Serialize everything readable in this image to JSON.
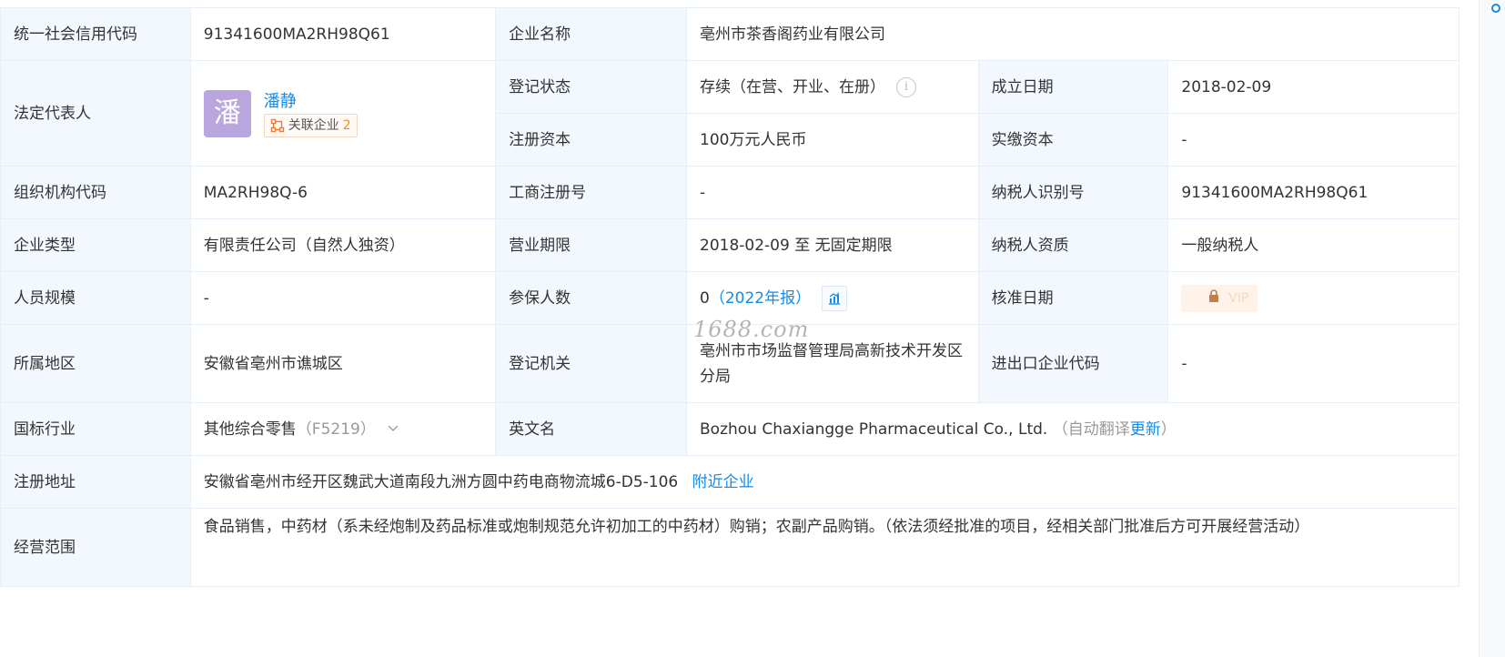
{
  "labels": {
    "credit_code": "统一社会信用代码",
    "company_name": "企业名称",
    "legal_rep": "法定代表人",
    "reg_status": "登记状态",
    "founded": "成立日期",
    "reg_capital": "注册资本",
    "paid_capital": "实缴资本",
    "org_code": "组织机构代码",
    "biz_reg_no": "工商注册号",
    "taxpayer_id": "纳税人识别号",
    "company_type": "企业类型",
    "biz_term": "营业期限",
    "taxpayer_qual": "纳税人资质",
    "staff_size": "人员规模",
    "insured": "参保人数",
    "approved_date": "核准日期",
    "region": "所属地区",
    "reg_authority": "登记机关",
    "import_export": "进出口企业代码",
    "industry": "国标行业",
    "english_name": "英文名",
    "address": "注册地址",
    "scope": "经营范围"
  },
  "values": {
    "credit_code": "91341600MA2RH98Q61",
    "company_name": "亳州市茶香阁药业有限公司",
    "legal_rep": {
      "avatar_char": "潘",
      "name": "潘静",
      "related_label": "关联企业",
      "related_count": "2"
    },
    "reg_status": "存续（在营、开业、在册）",
    "founded": "2018-02-09",
    "reg_capital": "100万元人民币",
    "paid_capital": "-",
    "org_code": "MA2RH98Q-6",
    "biz_reg_no": "-",
    "taxpayer_id": "91341600MA2RH98Q61",
    "company_type": "有限责任公司（自然人独资）",
    "biz_term": "2018-02-09 至 无固定期限",
    "taxpayer_qual": "一般纳税人",
    "staff_size": "-",
    "insured": {
      "count": "0",
      "report": "（2022年报）"
    },
    "approved_date": {
      "badge": "VIP"
    },
    "region": "安徽省亳州市谯城区",
    "reg_authority": "亳州市市场监督管理局高新技术开发区分局",
    "import_export": "-",
    "industry": {
      "name": "其他综合零售",
      "code": "（F5219）"
    },
    "english_name": {
      "name": "Bozhou Chaxiangge Pharmaceutical Co., Ltd.",
      "auto_note": "（自动翻译",
      "update_link": "更新",
      "close_paren": "）"
    },
    "address": {
      "text": "安徽省亳州市经开区魏武大道南段九洲方圆中药电商物流城6-D5-106",
      "nearby_link": "附近企业"
    },
    "scope": "食品销售，中药材（系未经炮制及药品标准或炮制规范允许初加工的中药材）购销；农副产品购销。（依法须经批准的项目，经相关部门批准后方可开展经营活动）"
  },
  "watermark": "1688.com",
  "colors": {
    "label_bg": "#f2f8fe",
    "border": "#e6eef7",
    "link": "#128bed",
    "avatar": "#b9a6df",
    "count_orange": "#fa8c16"
  },
  "icons": [
    "info-icon",
    "related-network-icon",
    "report-chart-icon",
    "lock-icon",
    "chevron-down-icon"
  ]
}
